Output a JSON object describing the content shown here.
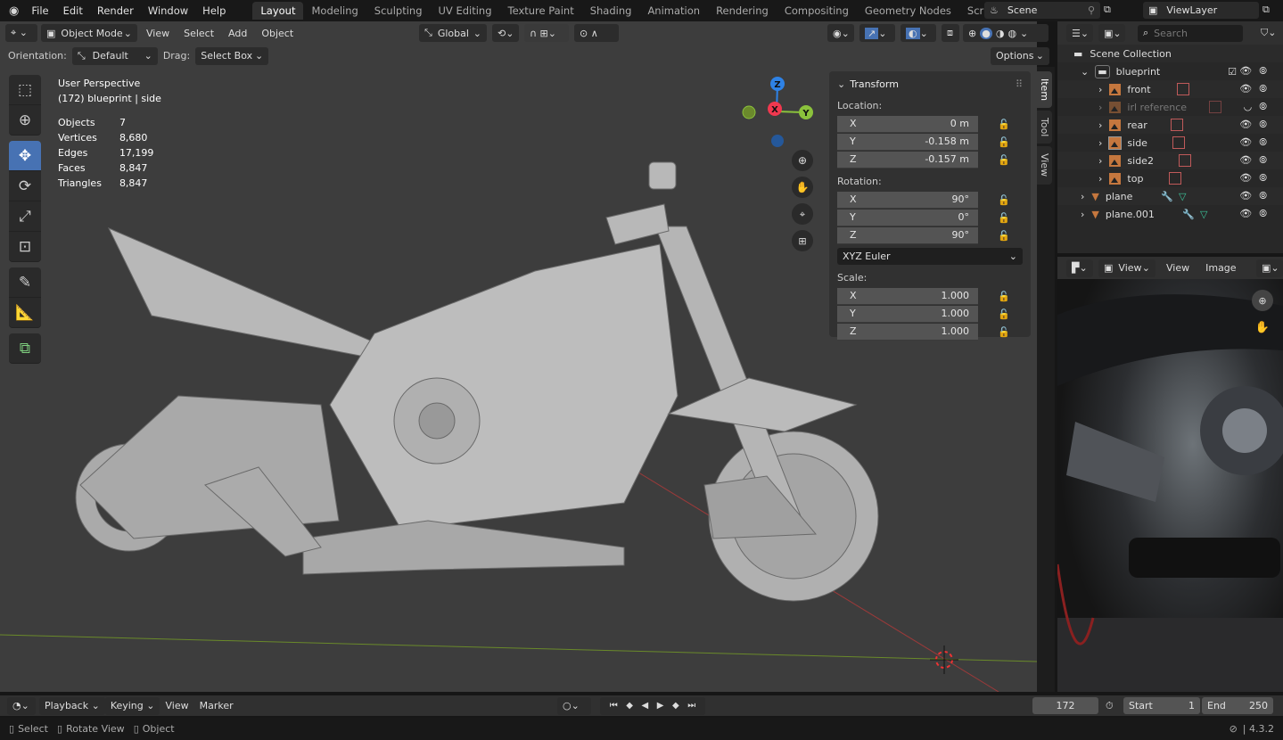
{
  "topbar": {
    "menus": [
      "File",
      "Edit",
      "Render",
      "Window",
      "Help"
    ],
    "workspaces": [
      "Layout",
      "Modeling",
      "Sculpting",
      "UV Editing",
      "Texture Paint",
      "Shading",
      "Animation",
      "Rendering",
      "Compositing",
      "Geometry Nodes",
      "Scripting"
    ],
    "active_workspace": "Layout",
    "scene": "Scene",
    "view_layer": "ViewLayer"
  },
  "viewport_header": {
    "mode": "Object Mode",
    "menus": [
      "View",
      "Select",
      "Add",
      "Object"
    ],
    "orientation_global": "Global"
  },
  "tool_settings": {
    "orientation_label": "Orientation:",
    "orientation_value": "Default",
    "drag_label": "Drag:",
    "drag_value": "Select Box",
    "options": "Options"
  },
  "overlay_text": {
    "perspective": "User Perspective",
    "object": "(172) blueprint | side",
    "stats": [
      {
        "label": "Objects",
        "value": "7"
      },
      {
        "label": "Vertices",
        "value": "8,680"
      },
      {
        "label": "Edges",
        "value": "17,199"
      },
      {
        "label": "Faces",
        "value": "8,847"
      },
      {
        "label": "Triangles",
        "value": "8,847"
      }
    ]
  },
  "gizmo": {
    "x": "X",
    "y": "Y",
    "z": "Z"
  },
  "npanel": {
    "title": "Transform",
    "location_label": "Location:",
    "location": [
      {
        "axis": "X",
        "value": "0 m"
      },
      {
        "axis": "Y",
        "value": "-0.158 m"
      },
      {
        "axis": "Z",
        "value": "-0.157 m"
      }
    ],
    "rotation_label": "Rotation:",
    "rotation": [
      {
        "axis": "X",
        "value": "90°"
      },
      {
        "axis": "Y",
        "value": "0°"
      },
      {
        "axis": "Z",
        "value": "90°"
      }
    ],
    "rotation_mode": "XYZ Euler",
    "scale_label": "Scale:",
    "scale": [
      {
        "axis": "X",
        "value": "1.000"
      },
      {
        "axis": "Y",
        "value": "1.000"
      },
      {
        "axis": "Z",
        "value": "1.000"
      }
    ],
    "tabs": [
      "Item",
      "Tool",
      "View"
    ]
  },
  "outliner": {
    "search_placeholder": "Search",
    "root": "Scene Collection",
    "collection": "blueprint",
    "children": [
      "front",
      "irl reference",
      "rear",
      "side",
      "side2",
      "top"
    ],
    "objects": [
      "plane",
      "plane.001"
    ]
  },
  "image_editor": {
    "view_menu": "View",
    "menus": [
      "View",
      "Image"
    ]
  },
  "timeline": {
    "menus": [
      "Playback",
      "Keying",
      "View",
      "Marker"
    ],
    "current_frame": "172",
    "start_label": "Start",
    "start": "1",
    "end_label": "End",
    "end": "250"
  },
  "statusbar": {
    "items": [
      "Select",
      "Rotate View",
      "Object"
    ],
    "version": "4.3.2"
  },
  "colors": {
    "accent": "#4772b3",
    "x_axis": "#f0384f",
    "y_axis": "#8bc23c",
    "z_axis": "#2e82e6",
    "object_orange": "#c5773e"
  }
}
